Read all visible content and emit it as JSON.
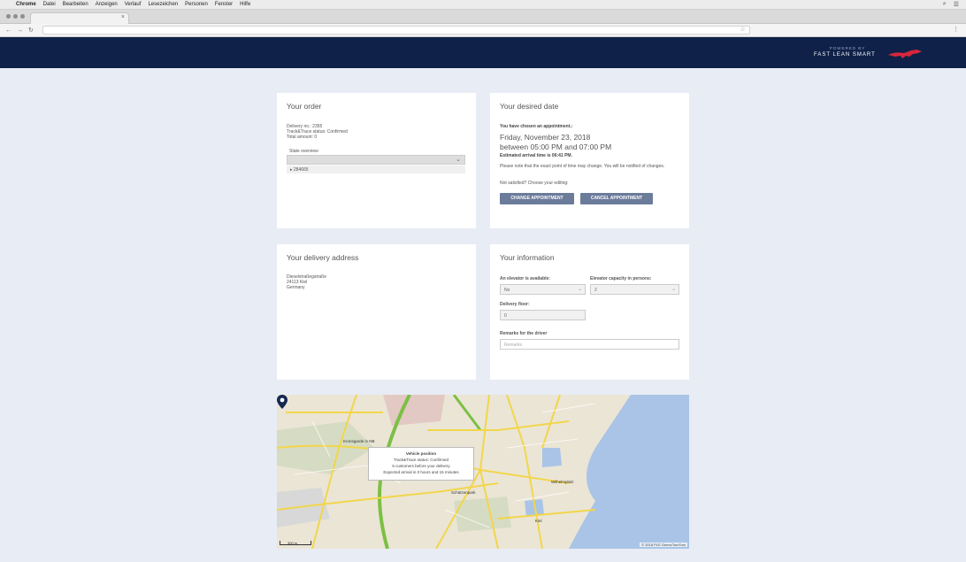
{
  "mac_menu": {
    "app": "Chrome",
    "items": [
      "Datei",
      "Bearbeiten",
      "Anzeigen",
      "Verlauf",
      "Lesezeichen",
      "Personen",
      "Fenster",
      "Hilfe"
    ]
  },
  "header": {
    "powered_by": "POWERED BY",
    "brand": "FAST LEAN SMART",
    "accent_color": "#d7263d",
    "bg_color": "#0f2148"
  },
  "order": {
    "title": "Your order",
    "delivery_no": "Delivery no.: 2355",
    "status": "Track&Trace status: Confirmed",
    "total": "Total amount: 0",
    "state_label": "State overview",
    "state_item": "284665"
  },
  "date": {
    "title": "Your desired date",
    "intro": "You have chosen an appointment.:",
    "day": "Friday, November 23, 2018",
    "window": "between 05:00 PM and 07:00 PM",
    "eta": "Estimated arrival time is 06:41 PM.",
    "note": "Please note that the exact point of time may change. You will be notified of changes.",
    "prompt": "Not satisfied? Choose your editing:",
    "change_button": "CHANGE APPOINTMENT",
    "cancel_button": "CANCEL APPOINTMENT"
  },
  "address": {
    "title": "Your delivery address",
    "street": "Dieselstraßegstraße",
    "city": "24113 Kiel",
    "country": "Germany"
  },
  "info": {
    "title": "Your information",
    "elevator_label": "An elevator is available:",
    "elevator_value": "No",
    "capacity_label": "Elevator capacity in persons:",
    "capacity_value": "2",
    "floor_label": "Delivery floor:",
    "floor_value": "0",
    "remarks_label": "Remarks for the driver",
    "remarks_placeholder": "Remarks"
  },
  "map": {
    "popup_title": "Vehicle position",
    "popup_status": "Track&Trace status: Confirmed",
    "popup_customers": "5 customers before your delivery",
    "popup_eta": "Expected arrival in 0 hours and 15 minutes",
    "label_1": "Kronsgarde in NB",
    "label_2": "Wilhelmplatz",
    "label_3": "Schützenpark",
    "label_4": "Kiel",
    "copyright": "© 2018 PLE Geers/TomTom",
    "scale": "300 m"
  }
}
